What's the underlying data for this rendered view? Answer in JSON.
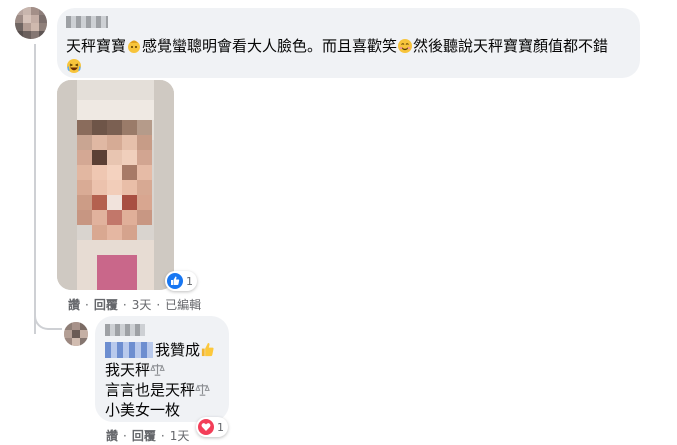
{
  "comment": {
    "author": "",
    "text_lines": [
      [
        "天秤寶寶",
        "感覺蠻聰明會看大人臉色。而且喜歡笑",
        "然後聽說天秤寶寶顏值都不錯"
      ],
      [
        ""
      ]
    ],
    "emojis": {
      "e1": "face",
      "e2": "smile",
      "e3": "laugh"
    },
    "reaction": {
      "icon": "like-icon",
      "count": "1"
    },
    "actions": {
      "like": "讚",
      "reply": "回覆",
      "time": "3天",
      "edited": "已編輯"
    }
  },
  "reply": {
    "author": "",
    "lines": {
      "l1": "我贊成",
      "l2": "我天秤",
      "l3": "言言也是天秤",
      "l4": "小美女一枚"
    },
    "reaction": {
      "icon": "heart-icon",
      "count": "1"
    },
    "actions": {
      "like": "讚",
      "reply": "回覆",
      "time": "1天"
    }
  },
  "colors": {
    "bubble": "#f0f2f5",
    "meta_text": "#65676b",
    "like_blue": "#1877f2",
    "love_red": "#f33e58"
  }
}
